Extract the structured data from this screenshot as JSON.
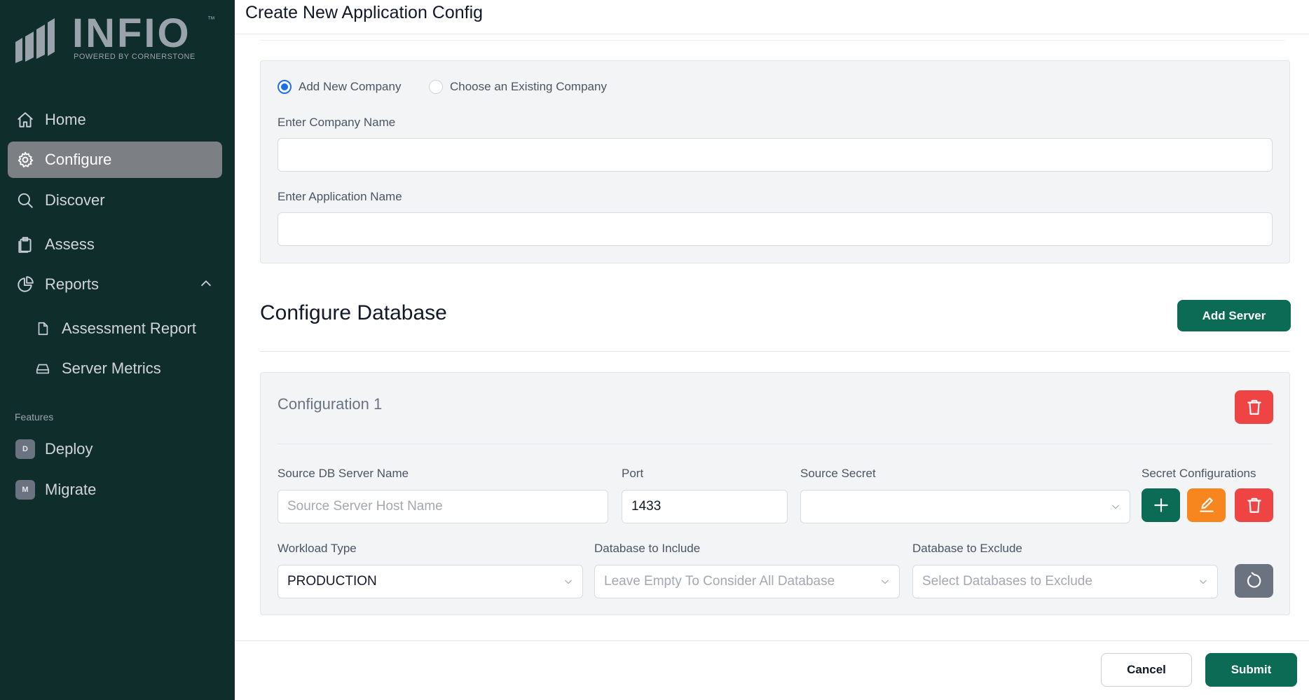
{
  "sidebar": {
    "logo_text": "INFIO",
    "logo_tm": "™",
    "logo_tagline": "POWERED BY CORNERSTONE",
    "items": [
      {
        "label": "Home",
        "icon": "home-icon"
      },
      {
        "label": "Configure",
        "icon": "gear-icon",
        "active": true
      },
      {
        "label": "Discover",
        "icon": "search-icon"
      },
      {
        "label": "Assess",
        "icon": "clipboard-icon"
      },
      {
        "label": "Reports",
        "icon": "pie-chart-icon",
        "expanded": true
      }
    ],
    "sub_items": [
      {
        "label": "Assessment Report",
        "icon": "file-icon"
      },
      {
        "label": "Server Metrics",
        "icon": "hard-drive-icon"
      }
    ],
    "features_label": "Features",
    "features": [
      {
        "label": "Deploy",
        "badge": "D"
      },
      {
        "label": "Migrate",
        "badge": "M"
      }
    ]
  },
  "header": {
    "title": "Create New Application Config"
  },
  "company": {
    "radio_new": "Add New Company",
    "radio_existing": "Choose an Existing Company",
    "selected": "Add New Company",
    "company_label": "Enter Company Name",
    "company_value": "",
    "app_label": "Enter Application Name",
    "app_value": ""
  },
  "database": {
    "heading": "Configure Database",
    "add_server": "Add Server",
    "configs": [
      {
        "title": "Configuration 1",
        "server_label": "Source DB Server Name",
        "server_placeholder": "Source Server Host Name",
        "port_label": "Port",
        "port_value": "1433",
        "secret_label": "Source Secret",
        "secret_value": "",
        "secret_cfg_label": "Secret Configurations",
        "workload_label": "Workload Type",
        "workload_value": "PRODUCTION",
        "include_label": "Database to Include",
        "include_placeholder": "Leave Empty To Consider All Database",
        "exclude_label": "Database to Exclude",
        "exclude_placeholder": "Select Databases to Exclude"
      }
    ]
  },
  "footer": {
    "cancel": "Cancel",
    "submit": "Submit"
  },
  "colors": {
    "sidebar_bg": "#0f2d2a",
    "primary_green": "#0b6b55",
    "danger_red": "#ef4444",
    "edit_orange": "#f7861e",
    "radio_blue": "#1d6fe8"
  }
}
